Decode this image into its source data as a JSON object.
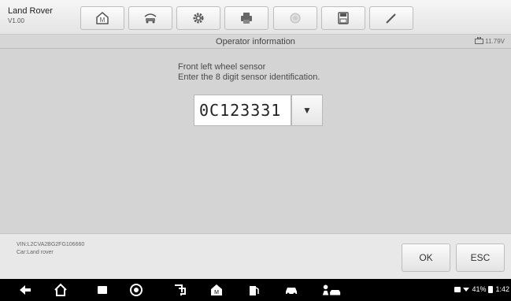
{
  "app": {
    "name": "Land Rover",
    "version": "V1.00"
  },
  "toolbar": {
    "buttons": [
      {
        "icon": "home-icon"
      },
      {
        "icon": "vehicle-swap-icon"
      },
      {
        "icon": "settings-icon"
      },
      {
        "icon": "print-icon"
      },
      {
        "icon": "help-icon"
      },
      {
        "icon": "save-icon"
      },
      {
        "icon": "edit-icon"
      }
    ]
  },
  "header": {
    "title": "Operator information",
    "battery_voltage": "11.79V"
  },
  "prompt": {
    "line1": "Front left wheel sensor",
    "line2": "Enter the 8 digit sensor identification."
  },
  "sensor": {
    "value": "0C123331",
    "dropdown_glyph": "▼"
  },
  "footer": {
    "vin": "VIN:L2CVA2BG2FG106660",
    "car": "Car:Land rover",
    "ok_label": "OK",
    "esc_label": "ESC"
  },
  "navbar": {
    "icons": [
      "back-icon",
      "home-icon",
      "recent-apps-icon",
      "chrome-icon",
      "connect-icon",
      "autel-home-icon",
      "fuel-icon",
      "car-icon",
      "vehicle-person-icon"
    ],
    "status": {
      "battery_percent": "41%",
      "time": "1:42"
    }
  },
  "colors": {
    "toolbar_bg": "#e4e4e4",
    "main_bg": "#d4d4d4",
    "navbar_bg": "#000000"
  }
}
